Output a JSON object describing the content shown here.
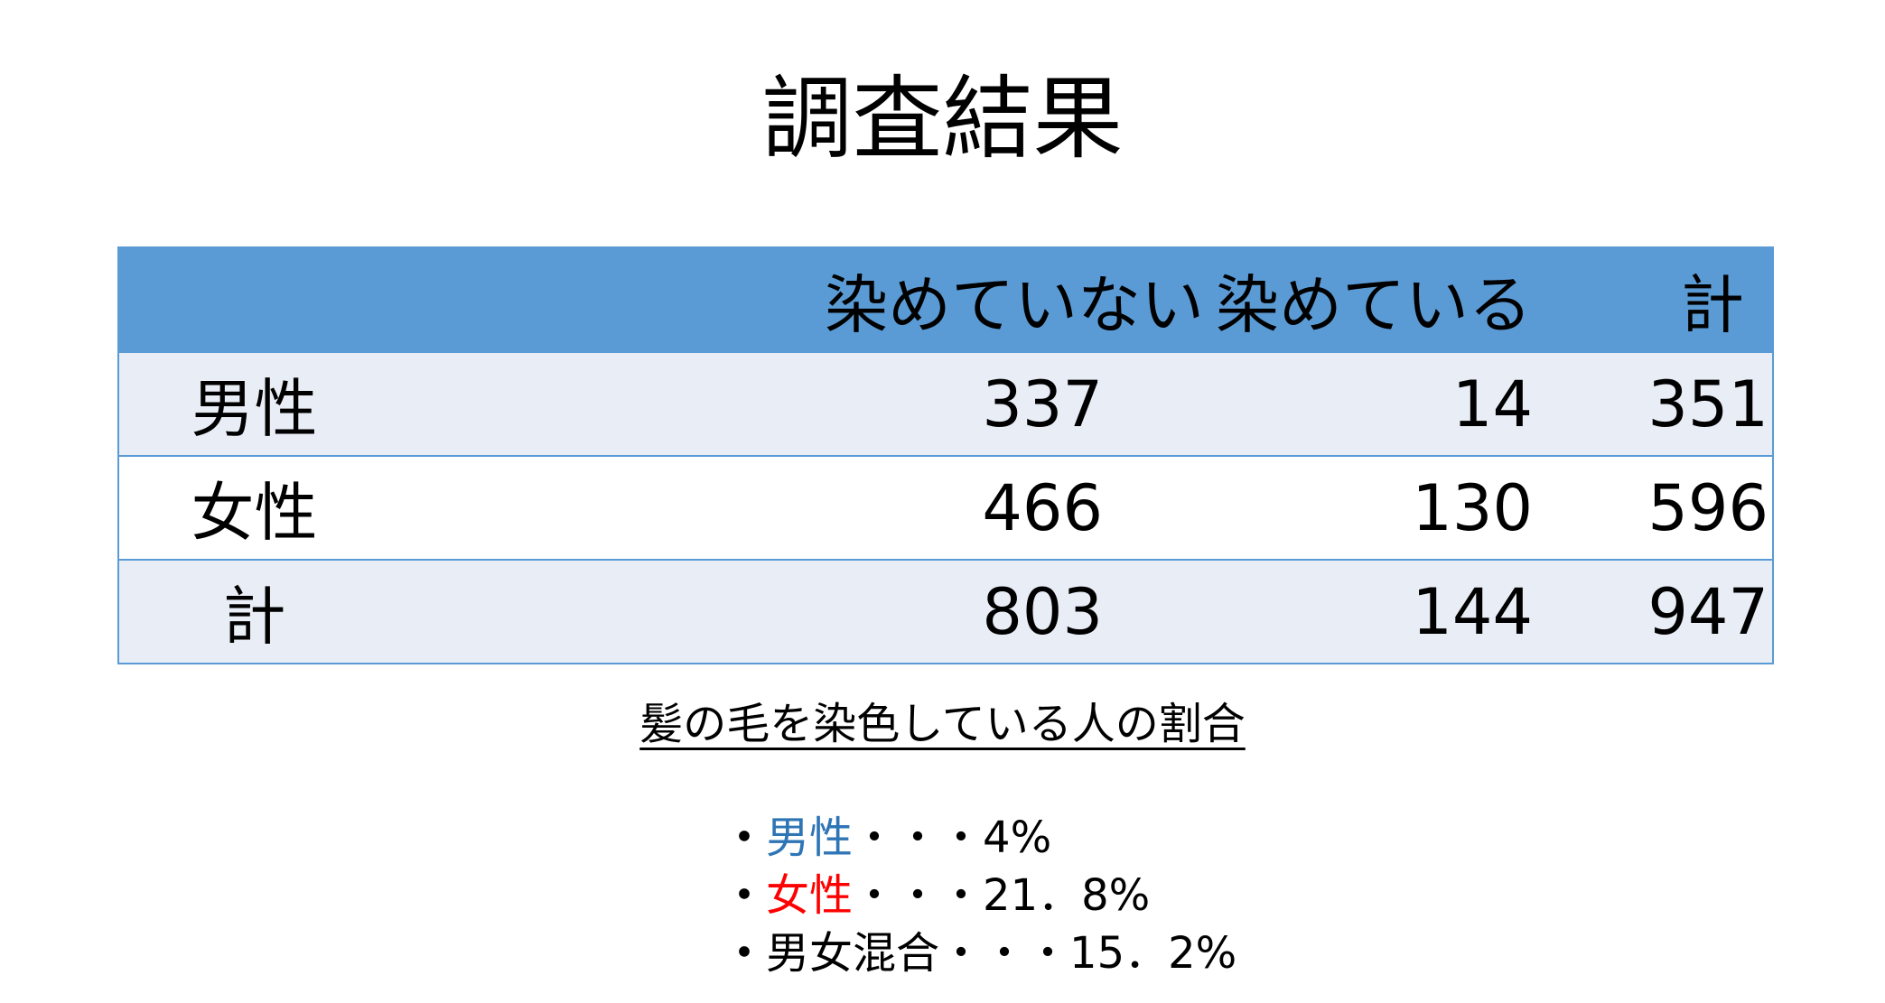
{
  "title": "調査結果",
  "table": {
    "headers": [
      "",
      "染めていない",
      "染めている",
      "計"
    ],
    "rows": [
      {
        "label": "男性",
        "not_dyed": "337",
        "dyed": "14",
        "total": "351"
      },
      {
        "label": "女性",
        "not_dyed": "466",
        "dyed": "130",
        "total": "596"
      },
      {
        "label": "計",
        "not_dyed": "803",
        "dyed": "144",
        "total": "947"
      }
    ]
  },
  "subtitle": "髪の毛を染色している人の割合",
  "bullets": [
    {
      "marker": "・",
      "label": "男性",
      "label_color": "#2e75b6",
      "value": "・・・4%"
    },
    {
      "marker": "・",
      "label": "女性",
      "label_color": "#ff0000",
      "value": "・・・21．8%"
    },
    {
      "marker": "・",
      "label": "男女混合",
      "label_color": "#000000",
      "value": "・・・15．2%"
    }
  ],
  "colors": {
    "header_fill": "#5b9bd5",
    "row_fill": "#e9edf6",
    "alt_row_fill": "#ffffff",
    "border": "#5b9bd5"
  }
}
